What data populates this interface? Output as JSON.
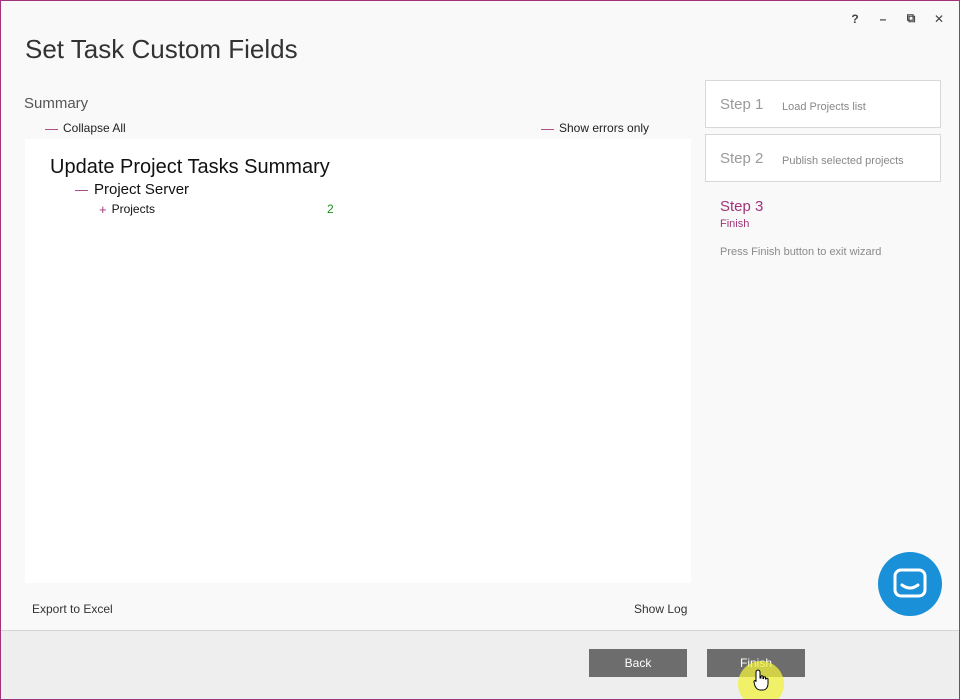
{
  "window": {
    "title": "Set Task Custom Fields",
    "controls": {
      "help": "?",
      "minimize": "–",
      "restore": "⧉",
      "close": "✕"
    }
  },
  "summary": {
    "label": "Summary",
    "collapse_all": "Collapse All",
    "show_errors_only": "Show errors only",
    "tree": {
      "root": "Update Project Tasks Summary",
      "server": "Project Server",
      "projects_label": "Projects",
      "projects_count": "2"
    },
    "export_to_excel": "Export to Excel",
    "show_log": "Show Log"
  },
  "steps": [
    {
      "number": "Step 1",
      "name": "Load Projects list"
    },
    {
      "number": "Step 2",
      "name": "Publish selected projects"
    },
    {
      "number": "Step 3",
      "name": "Finish",
      "description": "Press Finish button to exit wizard",
      "active": true
    }
  ],
  "footer": {
    "back_label": "Back",
    "finish_label": "Finish"
  },
  "colors": {
    "accent": "#a0337a",
    "button": "#6d6d6d",
    "chat": "#1a90d9",
    "count": "#1a8f1a"
  },
  "icons": {
    "chat": "chat-bubble-icon",
    "cursor": "hand-cursor-icon"
  }
}
